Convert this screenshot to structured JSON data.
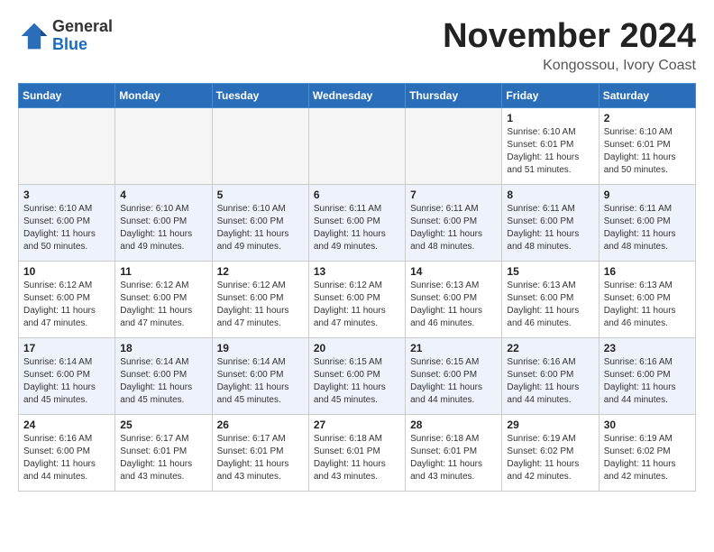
{
  "header": {
    "logo_general": "General",
    "logo_blue": "Blue",
    "month_title": "November 2024",
    "location": "Kongossou, Ivory Coast"
  },
  "weekdays": [
    "Sunday",
    "Monday",
    "Tuesday",
    "Wednesday",
    "Thursday",
    "Friday",
    "Saturday"
  ],
  "weeks": [
    [
      {
        "day": "",
        "empty": true
      },
      {
        "day": "",
        "empty": true
      },
      {
        "day": "",
        "empty": true
      },
      {
        "day": "",
        "empty": true
      },
      {
        "day": "",
        "empty": true
      },
      {
        "day": "1",
        "sunrise": "6:10 AM",
        "sunset": "6:01 PM",
        "daylight": "11 hours and 51 minutes."
      },
      {
        "day": "2",
        "sunrise": "6:10 AM",
        "sunset": "6:01 PM",
        "daylight": "11 hours and 50 minutes."
      }
    ],
    [
      {
        "day": "3",
        "sunrise": "6:10 AM",
        "sunset": "6:00 PM",
        "daylight": "11 hours and 50 minutes."
      },
      {
        "day": "4",
        "sunrise": "6:10 AM",
        "sunset": "6:00 PM",
        "daylight": "11 hours and 49 minutes."
      },
      {
        "day": "5",
        "sunrise": "6:10 AM",
        "sunset": "6:00 PM",
        "daylight": "11 hours and 49 minutes."
      },
      {
        "day": "6",
        "sunrise": "6:11 AM",
        "sunset": "6:00 PM",
        "daylight": "11 hours and 49 minutes."
      },
      {
        "day": "7",
        "sunrise": "6:11 AM",
        "sunset": "6:00 PM",
        "daylight": "11 hours and 48 minutes."
      },
      {
        "day": "8",
        "sunrise": "6:11 AM",
        "sunset": "6:00 PM",
        "daylight": "11 hours and 48 minutes."
      },
      {
        "day": "9",
        "sunrise": "6:11 AM",
        "sunset": "6:00 PM",
        "daylight": "11 hours and 48 minutes."
      }
    ],
    [
      {
        "day": "10",
        "sunrise": "6:12 AM",
        "sunset": "6:00 PM",
        "daylight": "11 hours and 47 minutes."
      },
      {
        "day": "11",
        "sunrise": "6:12 AM",
        "sunset": "6:00 PM",
        "daylight": "11 hours and 47 minutes."
      },
      {
        "day": "12",
        "sunrise": "6:12 AM",
        "sunset": "6:00 PM",
        "daylight": "11 hours and 47 minutes."
      },
      {
        "day": "13",
        "sunrise": "6:12 AM",
        "sunset": "6:00 PM",
        "daylight": "11 hours and 47 minutes."
      },
      {
        "day": "14",
        "sunrise": "6:13 AM",
        "sunset": "6:00 PM",
        "daylight": "11 hours and 46 minutes."
      },
      {
        "day": "15",
        "sunrise": "6:13 AM",
        "sunset": "6:00 PM",
        "daylight": "11 hours and 46 minutes."
      },
      {
        "day": "16",
        "sunrise": "6:13 AM",
        "sunset": "6:00 PM",
        "daylight": "11 hours and 46 minutes."
      }
    ],
    [
      {
        "day": "17",
        "sunrise": "6:14 AM",
        "sunset": "6:00 PM",
        "daylight": "11 hours and 45 minutes."
      },
      {
        "day": "18",
        "sunrise": "6:14 AM",
        "sunset": "6:00 PM",
        "daylight": "11 hours and 45 minutes."
      },
      {
        "day": "19",
        "sunrise": "6:14 AM",
        "sunset": "6:00 PM",
        "daylight": "11 hours and 45 minutes."
      },
      {
        "day": "20",
        "sunrise": "6:15 AM",
        "sunset": "6:00 PM",
        "daylight": "11 hours and 45 minutes."
      },
      {
        "day": "21",
        "sunrise": "6:15 AM",
        "sunset": "6:00 PM",
        "daylight": "11 hours and 44 minutes."
      },
      {
        "day": "22",
        "sunrise": "6:16 AM",
        "sunset": "6:00 PM",
        "daylight": "11 hours and 44 minutes."
      },
      {
        "day": "23",
        "sunrise": "6:16 AM",
        "sunset": "6:00 PM",
        "daylight": "11 hours and 44 minutes."
      }
    ],
    [
      {
        "day": "24",
        "sunrise": "6:16 AM",
        "sunset": "6:00 PM",
        "daylight": "11 hours and 44 minutes."
      },
      {
        "day": "25",
        "sunrise": "6:17 AM",
        "sunset": "6:01 PM",
        "daylight": "11 hours and 43 minutes."
      },
      {
        "day": "26",
        "sunrise": "6:17 AM",
        "sunset": "6:01 PM",
        "daylight": "11 hours and 43 minutes."
      },
      {
        "day": "27",
        "sunrise": "6:18 AM",
        "sunset": "6:01 PM",
        "daylight": "11 hours and 43 minutes."
      },
      {
        "day": "28",
        "sunrise": "6:18 AM",
        "sunset": "6:01 PM",
        "daylight": "11 hours and 43 minutes."
      },
      {
        "day": "29",
        "sunrise": "6:19 AM",
        "sunset": "6:02 PM",
        "daylight": "11 hours and 42 minutes."
      },
      {
        "day": "30",
        "sunrise": "6:19 AM",
        "sunset": "6:02 PM",
        "daylight": "11 hours and 42 minutes."
      }
    ]
  ]
}
